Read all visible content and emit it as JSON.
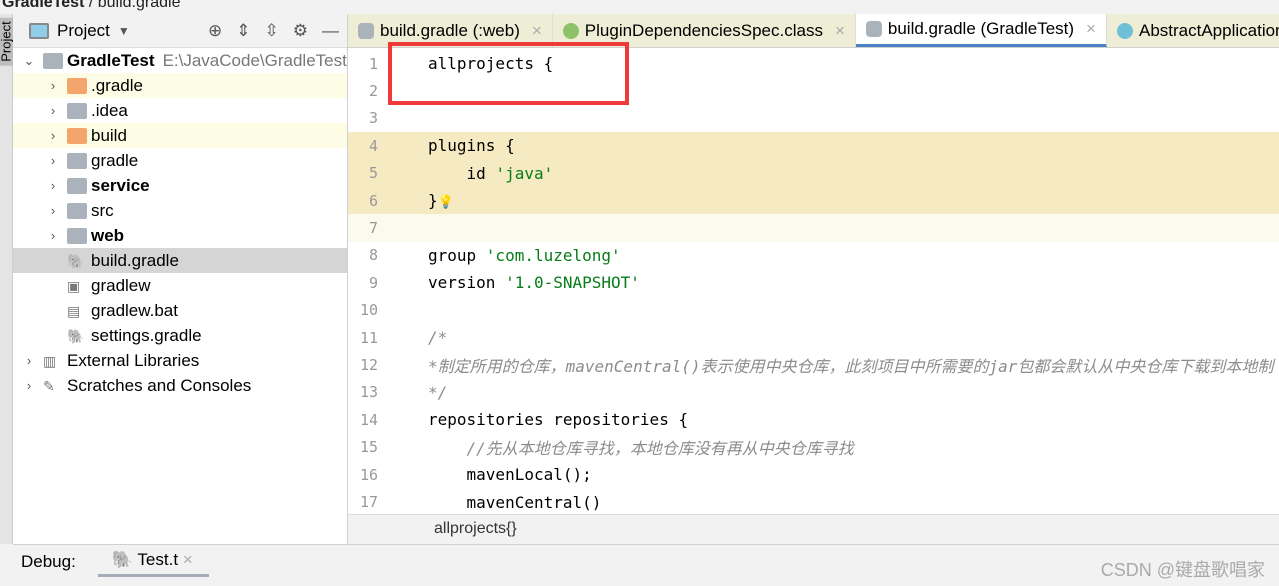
{
  "breadcrumb": {
    "project": "GradleTest",
    "file": "build.gradle"
  },
  "side_strip": {
    "label": "Project"
  },
  "project_panel": {
    "title": "Project",
    "tree": [
      {
        "label": "GradleTest",
        "path": "E:\\JavaCode\\GradleTest",
        "bold": true,
        "level": 0,
        "expanded": true,
        "icon": "module"
      },
      {
        "label": ".gradle",
        "level": 1,
        "icon": "folder-orange",
        "hl": true
      },
      {
        "label": ".idea",
        "level": 1,
        "icon": "folder-grey"
      },
      {
        "label": "build",
        "level": 1,
        "icon": "folder-orange",
        "hl": true
      },
      {
        "label": "gradle",
        "level": 1,
        "icon": "folder-grey"
      },
      {
        "label": "service",
        "level": 1,
        "icon": "module-folder",
        "bold": true
      },
      {
        "label": "src",
        "level": 1,
        "icon": "folder-grey"
      },
      {
        "label": "web",
        "level": 1,
        "icon": "module-folder",
        "bold": true
      },
      {
        "label": "build.gradle",
        "level": 1,
        "icon": "gradle",
        "selected": true
      },
      {
        "label": "gradlew",
        "level": 1,
        "icon": "shell"
      },
      {
        "label": "gradlew.bat",
        "level": 1,
        "icon": "file"
      },
      {
        "label": "settings.gradle",
        "level": 1,
        "icon": "gradle"
      },
      {
        "label": "External Libraries",
        "level": 0,
        "icon": "libraries"
      },
      {
        "label": "Scratches and Consoles",
        "level": 0,
        "icon": "scratches"
      }
    ]
  },
  "tabs": [
    {
      "label": "build.gradle (:web)",
      "icon": "gradle"
    },
    {
      "label": "PluginDependenciesSpec.class",
      "icon": "interface"
    },
    {
      "label": "build.gradle (GradleTest)",
      "icon": "gradle",
      "active": true
    },
    {
      "label": "AbstractApplication",
      "icon": "class"
    }
  ],
  "code": [
    {
      "n": "1",
      "t": "allprojects {"
    },
    {
      "n": "2",
      "t": ""
    },
    {
      "n": "3",
      "t": ""
    },
    {
      "n": "4",
      "t": "plugins {"
    },
    {
      "n": "5",
      "t": "    id ",
      "s": "'java'"
    },
    {
      "n": "6",
      "t": "}"
    },
    {
      "n": "7",
      "t": ""
    },
    {
      "n": "8",
      "t": "group ",
      "s": "'com.luzelong'"
    },
    {
      "n": "9",
      "t": "version ",
      "s": "'1.0-SNAPSHOT'"
    },
    {
      "n": "10",
      "t": ""
    },
    {
      "n": "11",
      "c": "/*"
    },
    {
      "n": "12",
      "c": "*制定所用的仓库，mavenCentral()表示使用中央仓库，此刻项目中所需要的jar包都会默认从中央仓库下载到本地制"
    },
    {
      "n": "13",
      "c": "*/"
    },
    {
      "n": "14",
      "t": "repositories repositories {"
    },
    {
      "n": "15",
      "c": "    //先从本地仓库寻找，本地仓库没有再从中央仓库寻找"
    },
    {
      "n": "16",
      "t": "    mavenLocal();"
    },
    {
      "n": "17",
      "t": "    mavenCentral()"
    }
  ],
  "editor_breadcrumb": "allprojects{}",
  "debug": {
    "label": "Debug:",
    "tab": "Test.t"
  },
  "watermark": "CSDN @键盘歌唱家",
  "colors": {
    "accent": "#4a83c4",
    "highlight": "#f03a3a",
    "string": "#067d17"
  }
}
